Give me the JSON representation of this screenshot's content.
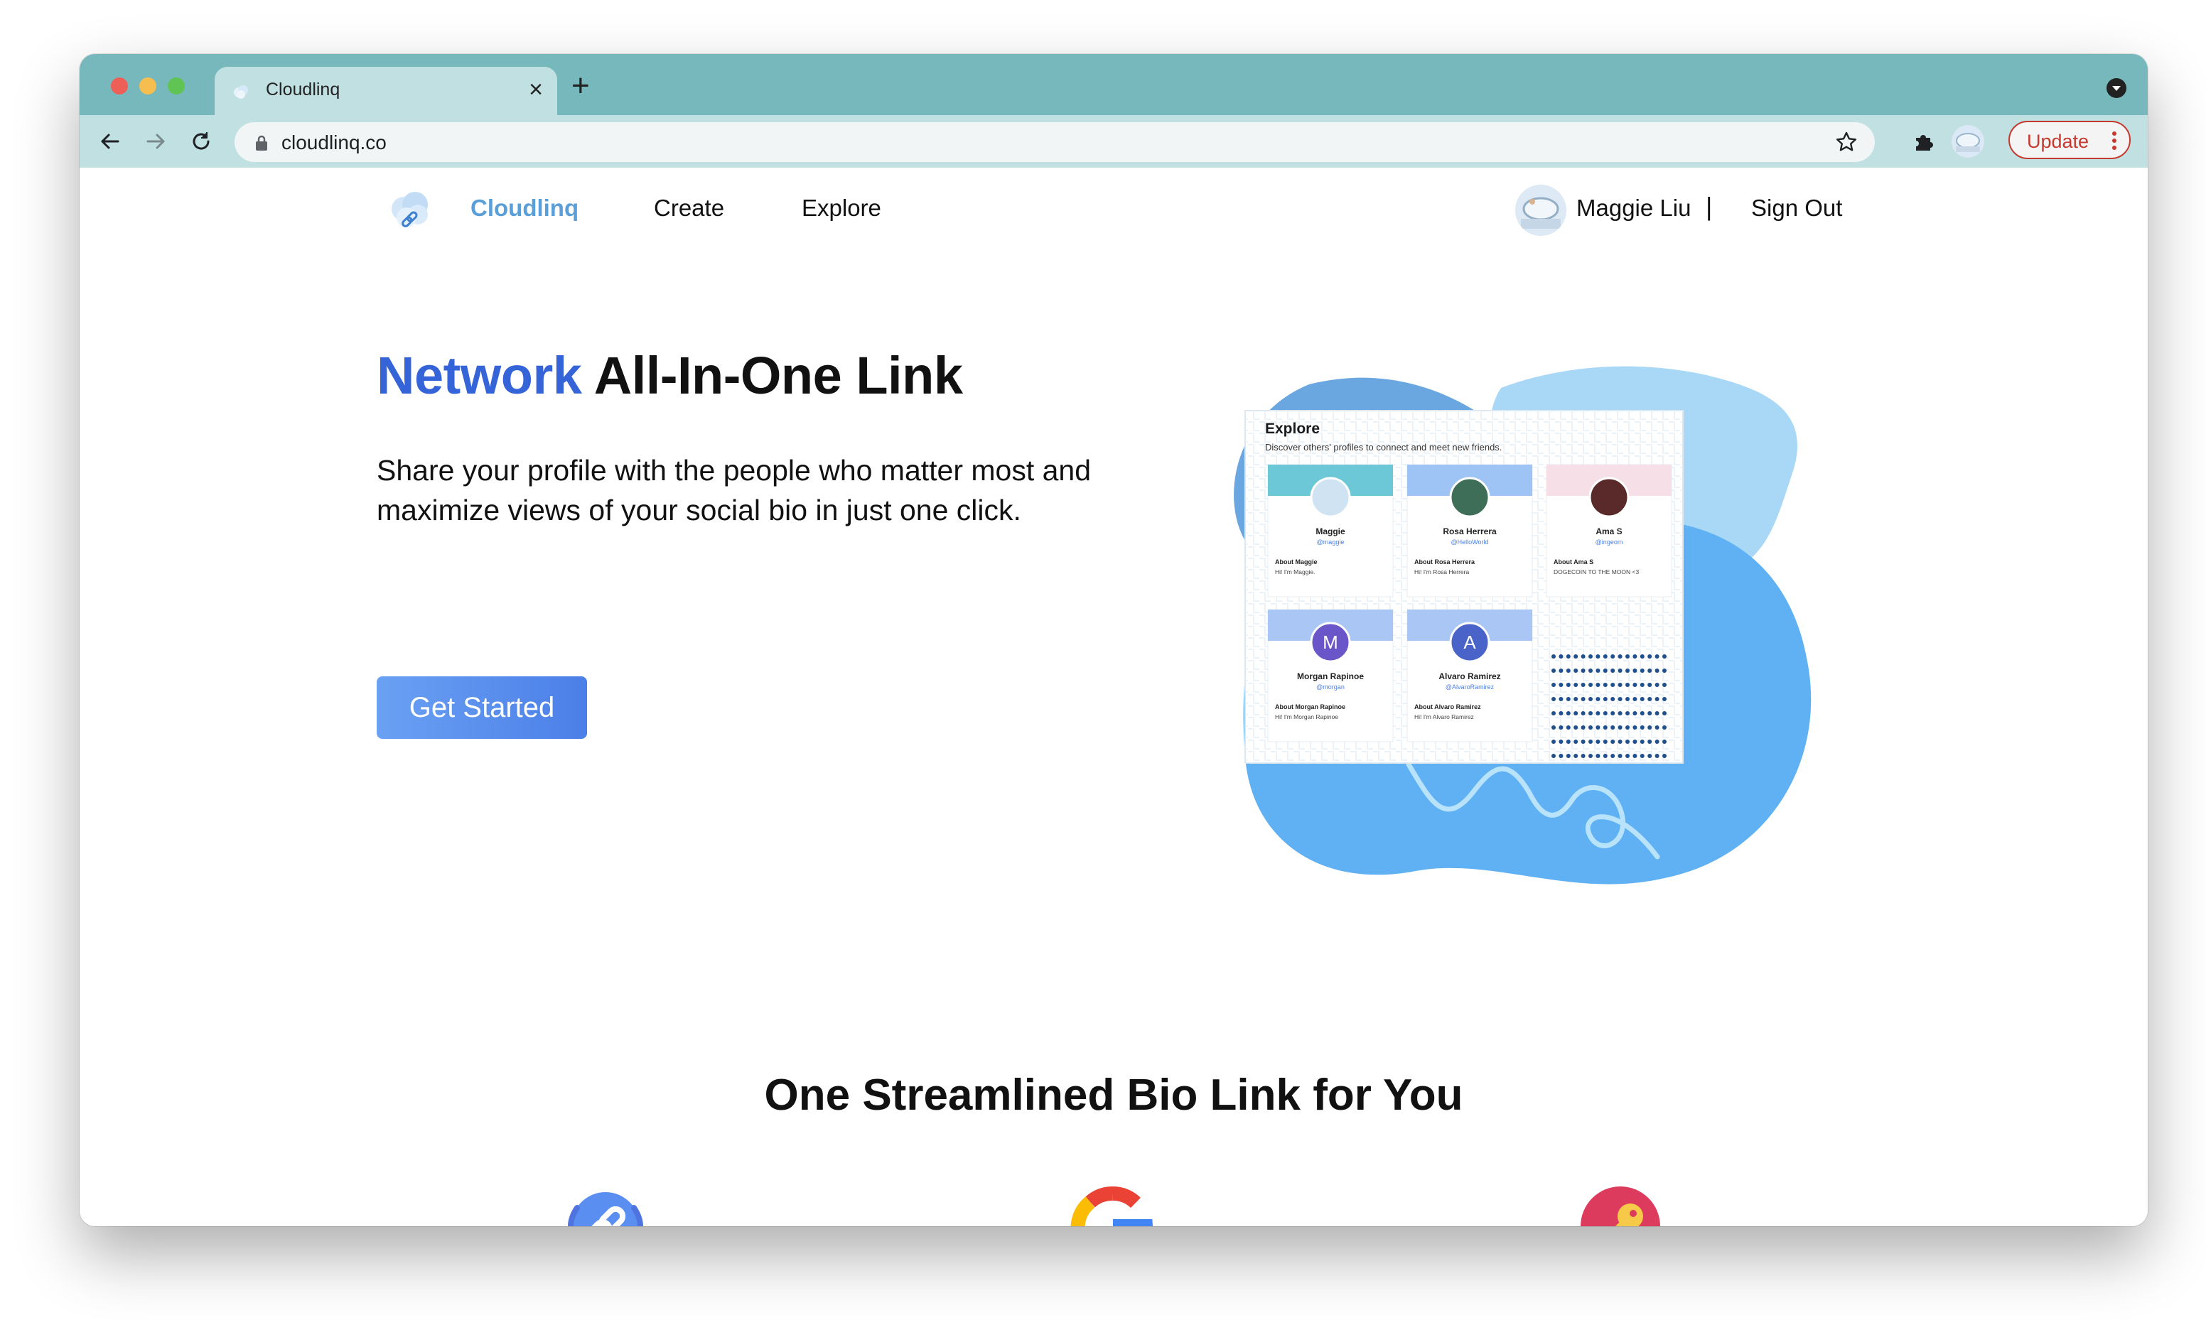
{
  "browser": {
    "tab": {
      "title": "Cloudlinq",
      "close": "×"
    },
    "new_tab": "+",
    "address": {
      "url": "cloudlinq.co"
    },
    "update_label": "Update"
  },
  "header": {
    "brand": "Cloudlinq",
    "nav": {
      "create": "Create",
      "explore": "Explore"
    },
    "user": {
      "name": "Maggie Liu",
      "divider": "|",
      "sign_out": "Sign Out"
    }
  },
  "hero": {
    "title_highlight": "Network",
    "title_rest": " All-In-One Link",
    "description": "Share your profile with the people who matter most and maximize views of your social bio in just one click.",
    "cta": "Get Started"
  },
  "preview": {
    "heading": "Explore",
    "subheading": "Discover others' profiles to connect and meet new friends.",
    "cards": [
      {
        "name": "Maggie",
        "handle": "@maggie",
        "about": "About Maggie",
        "bio": "Hi! I'm Maggie.",
        "initial": ""
      },
      {
        "name": "Rosa Herrera",
        "handle": "@HelloWorld",
        "about": "About Rosa Herrera",
        "bio": "Hi! I'm Rosa Herrera",
        "initial": ""
      },
      {
        "name": "Ama S",
        "handle": "@ingeom",
        "about": "About Ama S",
        "bio": "DOGECOIN TO THE MOON <3",
        "initial": ""
      },
      {
        "name": "Morgan Rapinoe",
        "handle": "@morgan",
        "about": "About Morgan Rapinoe",
        "bio": "Hi! I'm Morgan Rapinoe",
        "initial": "M"
      },
      {
        "name": "Alvaro Ramirez",
        "handle": "@AlvaroRamirez",
        "about": "About Alvaro Ramirez",
        "bio": "Hi! I'm Alvaro Ramirez",
        "initial": "A"
      }
    ]
  },
  "features": {
    "title": "One Streamlined Bio Link for You",
    "icons": [
      "link-icon",
      "google-icon",
      "key-icon"
    ]
  },
  "colors": {
    "accent": "#3563d8",
    "brand": "#5a9fd8",
    "button": "#5b8ff0",
    "tabstrip": "#77b8bd"
  }
}
